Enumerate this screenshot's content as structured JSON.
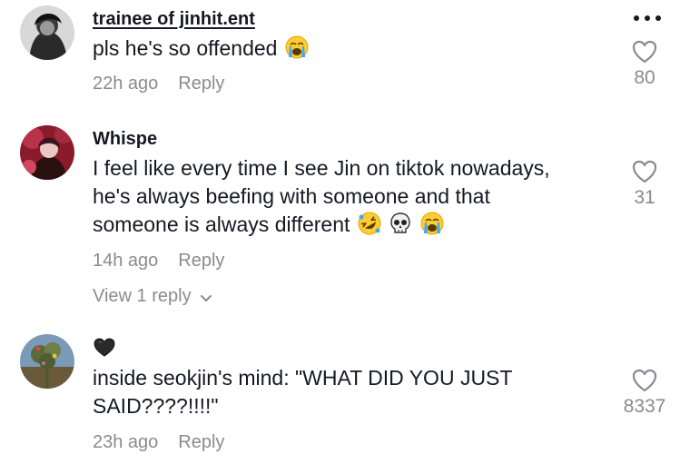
{
  "comments": [
    {
      "username": "trainee of jinhit.ent",
      "text": "pls he's so offended",
      "emojis": [
        "crying-emoji"
      ],
      "time": "22h ago",
      "reply_label": "Reply",
      "likes": "80",
      "has_more_menu": true
    },
    {
      "username": "Whispe",
      "text_lines": [
        "I feel like every time I see Jin on tiktok nowadays,",
        "he's always beefing with someone and that",
        "someone is always different"
      ],
      "emojis": [
        "rofl-emoji",
        "skull-emoji",
        "crying-emoji"
      ],
      "time": "14h ago",
      "reply_label": "Reply",
      "view_replies": "View 1 reply",
      "likes": "31"
    },
    {
      "username_icon": "black-heart-icon",
      "text_lines": [
        "inside seokjin's mind: \"WHAT DID YOU JUST",
        "SAID????!!!!\""
      ],
      "time": "23h ago",
      "reply_label": "Reply",
      "likes": "8337"
    }
  ]
}
